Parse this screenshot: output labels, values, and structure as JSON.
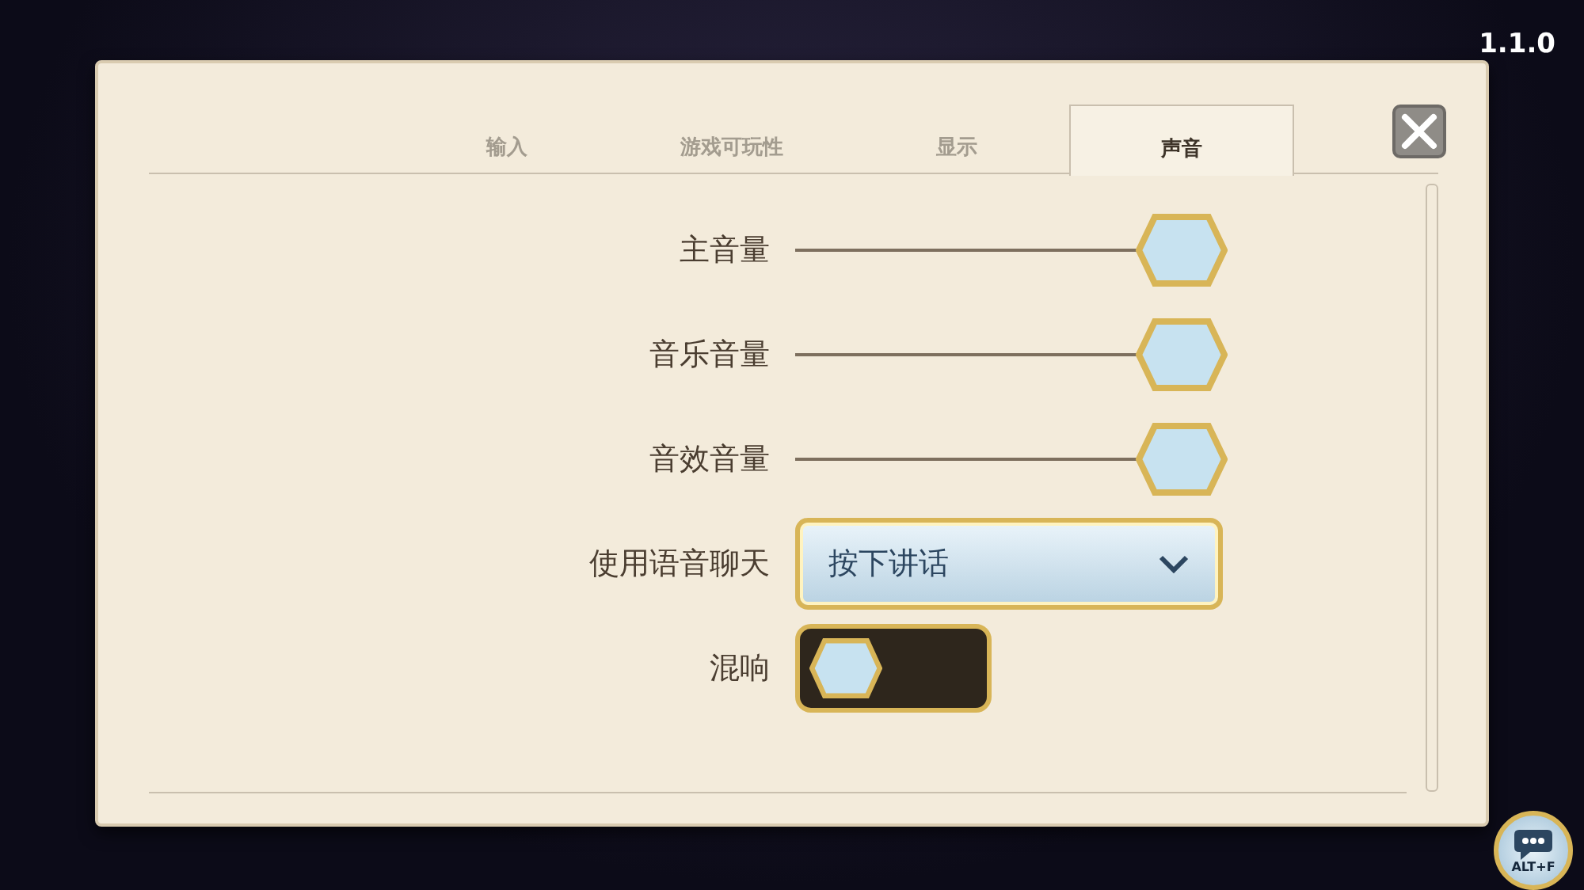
{
  "version": "1.1.0",
  "tabs": [
    {
      "label": "输入",
      "selected": false
    },
    {
      "label": "游戏可玩性",
      "selected": false
    },
    {
      "label": "显示",
      "selected": false
    },
    {
      "label": "声音",
      "selected": true
    }
  ],
  "settings": [
    {
      "kind": "slider",
      "label": "主音量",
      "level": 1
    },
    {
      "kind": "slider",
      "label": "音乐音量",
      "level": 1
    },
    {
      "kind": "slider",
      "label": "音效音量",
      "level": 1
    },
    {
      "kind": "dropdown",
      "label": "使用语音聊天",
      "value": "按下讲话"
    },
    {
      "kind": "toggle",
      "label": "混响",
      "on": false
    }
  ],
  "chat_button": {
    "label": "ALT+F"
  }
}
